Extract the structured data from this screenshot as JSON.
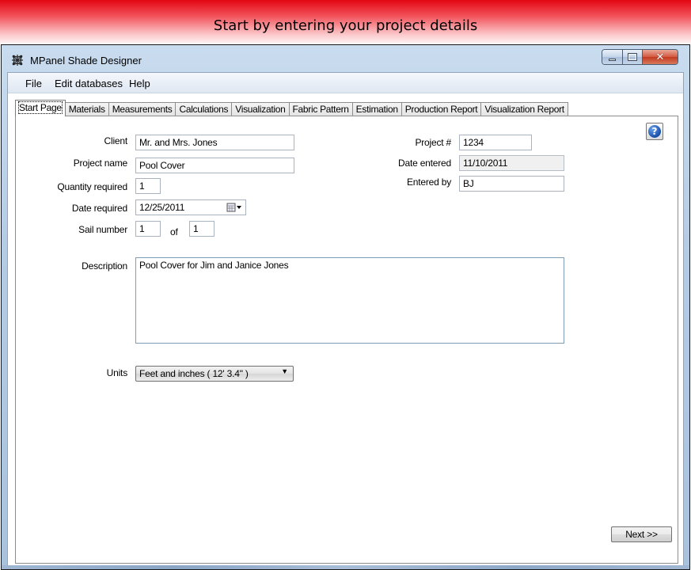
{
  "banner": {
    "title": "Start by entering your project details"
  },
  "window": {
    "title": "MPanel Shade Designer",
    "icon": "mesh-icon",
    "controls": {
      "minimize": "minimize-icon",
      "maximize": "maximize-icon",
      "close": "close-icon"
    }
  },
  "menu": {
    "items": [
      {
        "label": "File"
      },
      {
        "label": "Edit databases"
      },
      {
        "label": "Help"
      }
    ]
  },
  "tabs": [
    {
      "label": "Start Page",
      "active": true
    },
    {
      "label": "Materials"
    },
    {
      "label": "Measurements"
    },
    {
      "label": "Calculations"
    },
    {
      "label": "Visualization"
    },
    {
      "label": "Fabric Pattern"
    },
    {
      "label": "Estimation"
    },
    {
      "label": "Production Report"
    },
    {
      "label": "Visualization Report"
    }
  ],
  "form": {
    "client": {
      "label": "Client",
      "value": "Mr. and Mrs. Jones"
    },
    "project_name": {
      "label": "Project name",
      "value": "Pool Cover"
    },
    "quantity_required": {
      "label": "Quantity required",
      "value": "1"
    },
    "date_required": {
      "label": "Date required",
      "value": "12/25/2011"
    },
    "sail_number": {
      "label": "Sail number",
      "value": "1",
      "of_label": "of",
      "of_value": "1"
    },
    "project_no": {
      "label": "Project #",
      "value": "1234"
    },
    "date_entered": {
      "label": "Date entered",
      "value": "11/10/2011"
    },
    "entered_by": {
      "label": "Entered by",
      "value": "BJ"
    },
    "description": {
      "label": "Description",
      "value": "Pool Cover for Jim and Janice Jones"
    },
    "units": {
      "label": "Units",
      "value": "Feet and inches  ( 12' 3.4\" )"
    }
  },
  "buttons": {
    "next": "Next >>",
    "help": "?"
  },
  "colors": {
    "banner_red": "#e30613",
    "help_blue": "#1a4fa6",
    "window_frame": "#b4cbe4"
  }
}
